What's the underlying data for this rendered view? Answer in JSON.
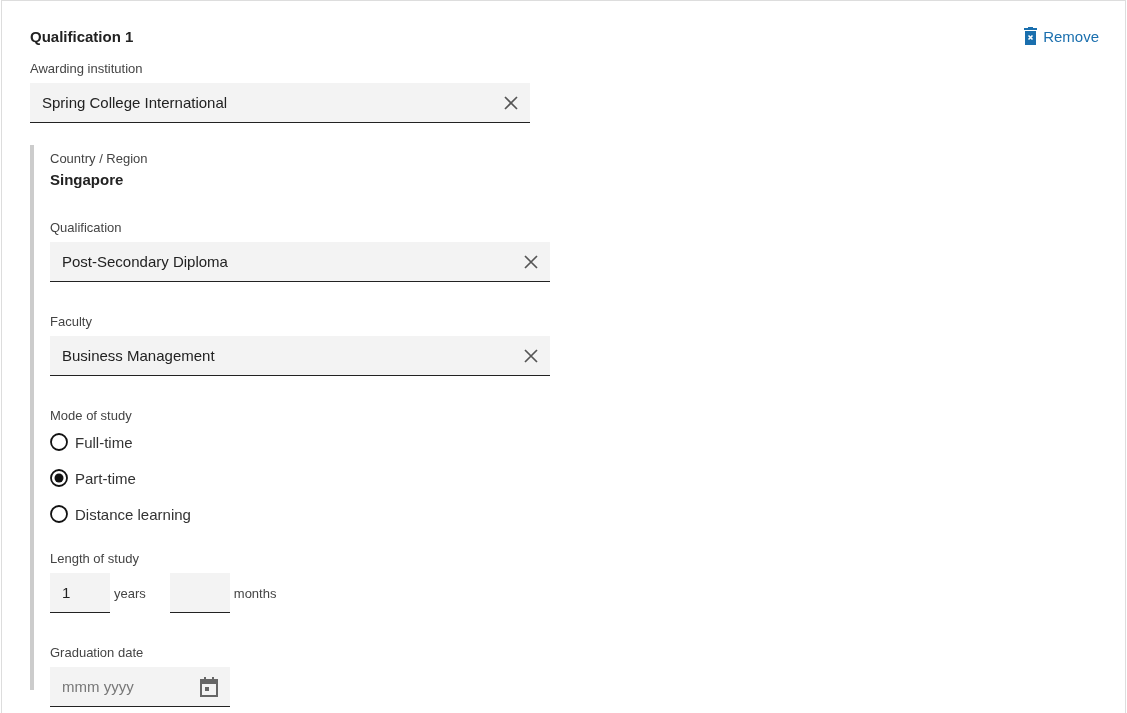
{
  "title": "Qualification 1",
  "remove": {
    "label": "Remove"
  },
  "institution": {
    "label": "Awarding institution",
    "value": "Spring College International"
  },
  "country": {
    "label": "Country / Region",
    "value": "Singapore"
  },
  "fields": [
    {
      "label": "Qualification",
      "value": "Post-Secondary Diploma"
    },
    {
      "label": "Faculty",
      "value": "Business Management"
    }
  ],
  "mode": {
    "label": "Mode of study",
    "options": [
      {
        "label": "Full-time",
        "selected": false
      },
      {
        "label": "Part-time",
        "selected": true
      },
      {
        "label": "Distance learning",
        "selected": false
      }
    ]
  },
  "length": {
    "label": "Length of study",
    "years": {
      "value": "1",
      "unit": "years"
    },
    "months": {
      "unit": "months"
    }
  },
  "graduation": {
    "label": "Graduation date",
    "placeholder": "mmm yyyy"
  }
}
